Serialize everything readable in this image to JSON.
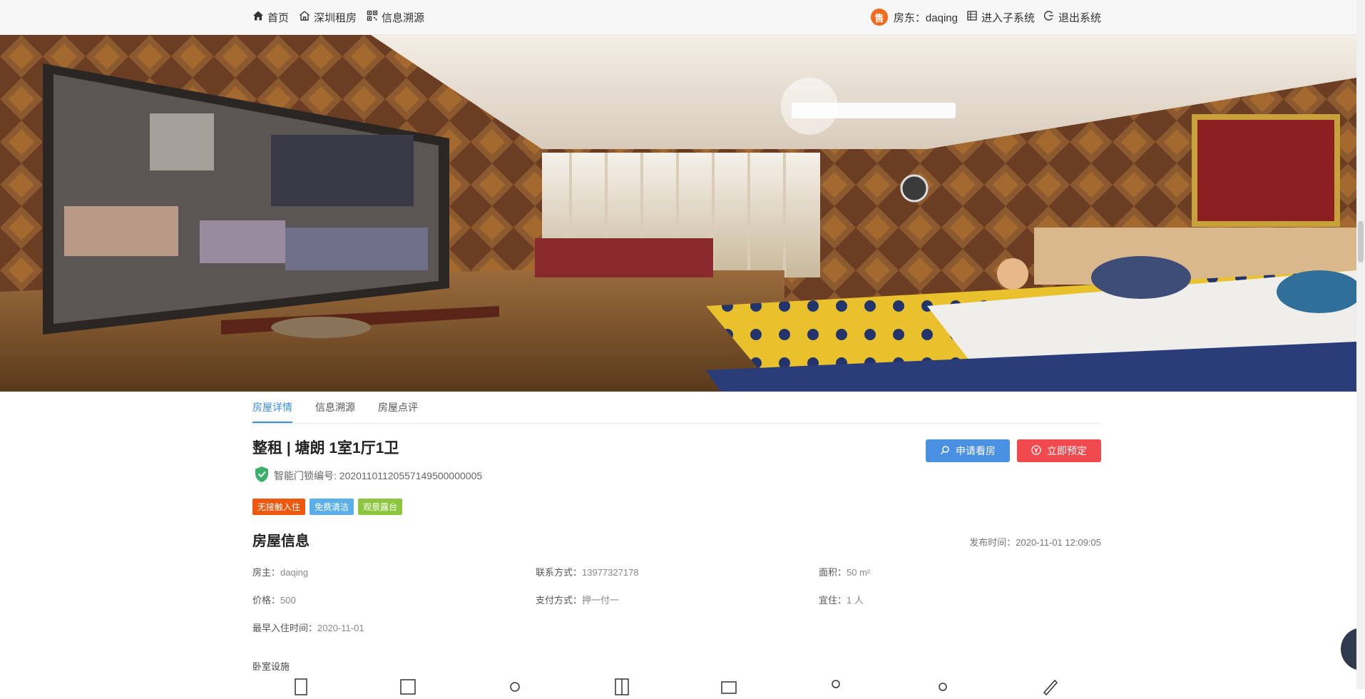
{
  "nav": {
    "home": "首页",
    "rent": "深圳租房",
    "trace": "信息溯源",
    "sell_badge": "售",
    "owner": "房东：daqing",
    "subsystem": "进入子系统",
    "logout": "退出系统"
  },
  "tabs": [
    "房屋详情",
    "信息溯源",
    "房屋点评"
  ],
  "house": {
    "title": "整租 | 塘朗 1室1厅1卫",
    "lock_label": "智能门锁编号: 20201101120557149500000005",
    "tags": [
      {
        "text": "无接触入住",
        "color": "#f0570e"
      },
      {
        "text": "免费清洁",
        "color": "#5aaeea"
      },
      {
        "text": "观景露台",
        "color": "#8cc63e"
      }
    ]
  },
  "buttons": {
    "view": "申请看房",
    "book": "立即预定"
  },
  "info": {
    "title": "房屋信息",
    "publish": "发布时间：2020-11-01 12:09:05",
    "fields": [
      {
        "k": "房主：",
        "v": "daqing"
      },
      {
        "k": "联系方式：",
        "v": "13977327178"
      },
      {
        "k": "面积：",
        "v": "50 m²"
      },
      {
        "k": "价格：",
        "v": "500"
      },
      {
        "k": "支付方式：",
        "v": "押一付一"
      },
      {
        "k": "宜住：",
        "v": "1 人"
      },
      {
        "k": "最早入住时间：",
        "v": "2020-11-01"
      }
    ]
  },
  "facilities_title": "卧室设施"
}
